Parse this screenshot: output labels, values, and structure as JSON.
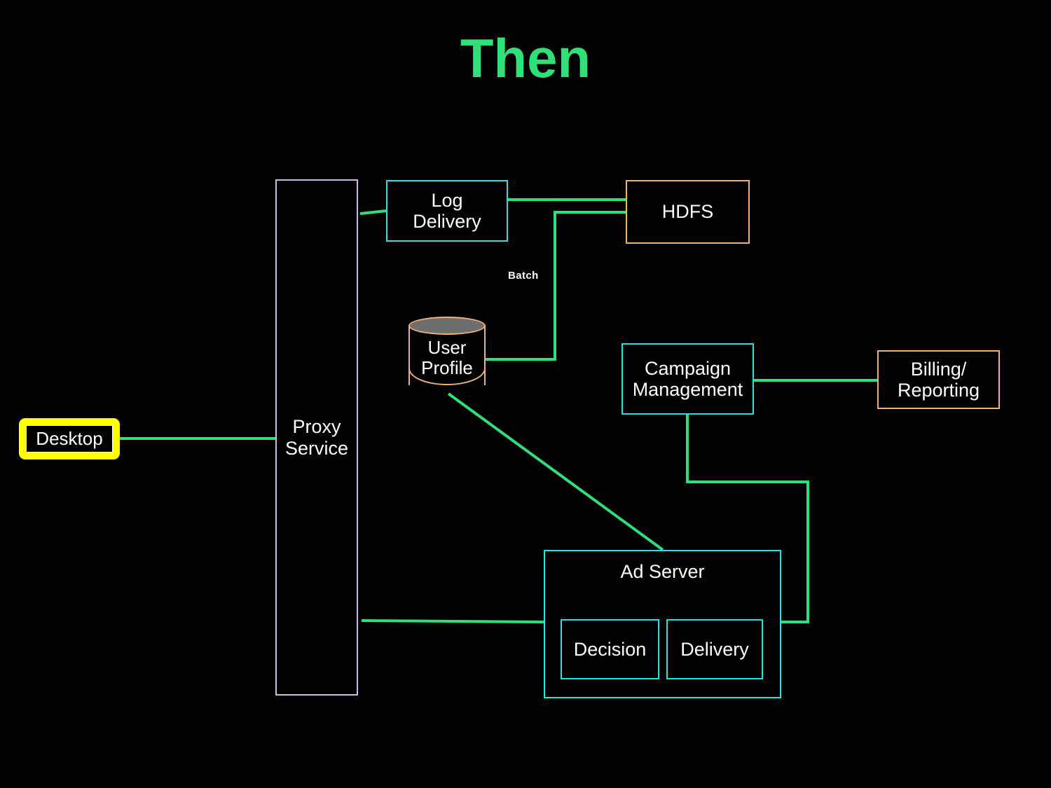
{
  "slide": {
    "title": "Then",
    "title_color": "#2fe079",
    "background": "#000000"
  },
  "palette": {
    "cyan_border": "#18e8e8",
    "orange_border": "#f2b077",
    "lavender_border": "#cdbce8",
    "highlight_yellow": "#ffff00",
    "wire_green": "#2fe079",
    "cylinder_top_fill": "#6e6e6e",
    "text_white": "#ffffff"
  },
  "nodes": {
    "desktop": {
      "label": "Desktop",
      "style": "highlighted-yellow"
    },
    "proxy_service": {
      "label": "Proxy\nService",
      "style": "lavender"
    },
    "log_delivery": {
      "label": "Log\nDelivery",
      "style": "cyan"
    },
    "hdfs": {
      "label": "HDFS",
      "style": "orange"
    },
    "user_profile": {
      "label": "User\nProfile",
      "style": "cylinder-orange"
    },
    "campaign_management": {
      "label": "Campaign\nManagement",
      "style": "cyan"
    },
    "billing_reporting": {
      "label": "Billing/\nReporting",
      "style": "orange"
    },
    "ad_server": {
      "label": "Ad Server",
      "style": "cyan"
    },
    "decision": {
      "label": "Decision",
      "style": "cyan"
    },
    "delivery": {
      "label": "Delivery",
      "style": "cyan"
    }
  },
  "edges": [
    {
      "from": "desktop",
      "to": "proxy_service",
      "label": ""
    },
    {
      "from": "proxy_service",
      "to": "log_delivery",
      "label": ""
    },
    {
      "from": "log_delivery",
      "to": "hdfs",
      "label": ""
    },
    {
      "from": "hdfs",
      "to": "user_profile",
      "label": "Batch"
    },
    {
      "from": "user_profile",
      "to": "ad_server",
      "label": ""
    },
    {
      "from": "campaign_management",
      "to": "billing_reporting",
      "label": ""
    },
    {
      "from": "campaign_management",
      "to": "ad_server",
      "label": ""
    },
    {
      "from": "proxy_service",
      "to": "ad_server",
      "label": ""
    }
  ],
  "edge_labels": {
    "batch": "Batch"
  }
}
